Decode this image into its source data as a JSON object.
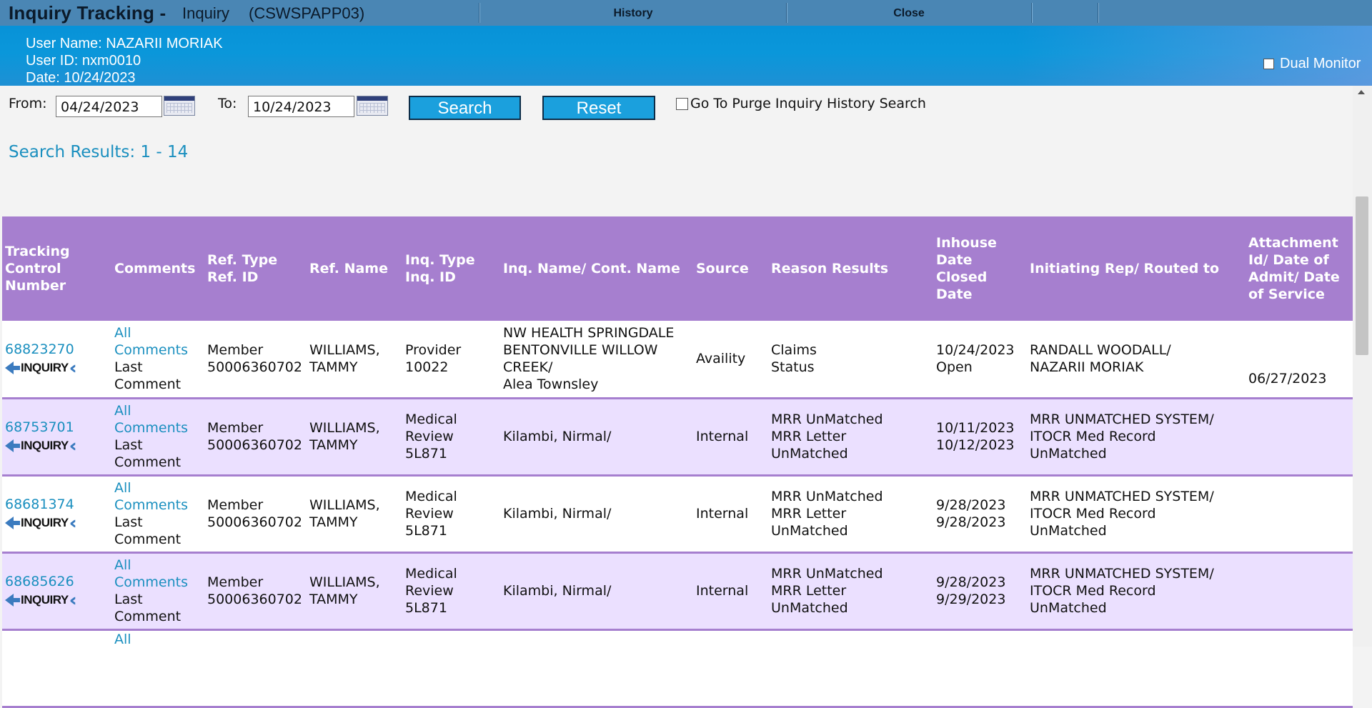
{
  "window": {
    "title": "Inquiry Tracking -",
    "subtitle": "Inquiry",
    "server": "(CSWSPAPP03)",
    "history_label": "History",
    "close_label": "Close"
  },
  "user": {
    "name_line": "User Name: NAZARII MORIAK",
    "id_line": "User ID: nxm0010",
    "date_line": "Date: 10/24/2023",
    "dual_monitor_label": "Dual Monitor",
    "dual_monitor_checked": false
  },
  "search": {
    "from_label": "From:",
    "from_value": "04/24/2023",
    "to_label": "To:",
    "to_value": "10/24/2023",
    "search_button": "Search",
    "reset_button": "Reset",
    "purge_label": "Go To Purge Inquiry History Search",
    "purge_checked": false,
    "results_text": "Search Results: 1 - 14"
  },
  "table": {
    "headers": [
      "Tracking Control Number",
      "Comments",
      "Ref. Type Ref. ID",
      "Ref. Name",
      "Inq. Type Inq. ID",
      "Inq. Name/ Cont. Name",
      "Source",
      "Reason Results",
      "Inhouse Date Closed Date",
      "Initiating Rep/ Routed to",
      "Attachment Id/ Date of Admit/ Date of Service"
    ],
    "logo_text": "INQUIRY",
    "all_comments_label": "All Comments",
    "last_comment_label": "Last Comment",
    "rows": [
      {
        "tracking": "68823270",
        "ref_type": "Member",
        "ref_id": "50006360702",
        "ref_name_1": "WILLIAMS,",
        "ref_name_2": "TAMMY",
        "inq_type_1": "Provider",
        "inq_type_2": "10022",
        "inq_type_3": "",
        "inq_name_1": "NW HEALTH SPRINGDALE",
        "inq_name_2": "BENTONVILLE WILLOW",
        "inq_name_3": "CREEK/",
        "inq_name_4": "Alea Townsley",
        "source": "Availity",
        "reason_1": "Claims",
        "reason_2": "Status",
        "reason_3": "",
        "inhouse_date": "10/24/2023",
        "closed_date": "Open",
        "rep_1": "RANDALL WOODALL/",
        "rep_2": "NAZARII MORIAK",
        "rep_3": "",
        "attachment": "06/27/2023"
      },
      {
        "tracking": "68753701",
        "ref_type": "Member",
        "ref_id": "50006360702",
        "ref_name_1": "WILLIAMS,",
        "ref_name_2": "TAMMY",
        "inq_type_1": "Medical",
        "inq_type_2": "Review",
        "inq_type_3": "5L871",
        "inq_name_1": "Kilambi, Nirmal/",
        "inq_name_2": "",
        "inq_name_3": "",
        "inq_name_4": "",
        "source": "Internal",
        "reason_1": "MRR UnMatched",
        "reason_2": "MRR Letter",
        "reason_3": "UnMatched",
        "inhouse_date": "10/11/2023",
        "closed_date": "10/12/2023",
        "rep_1": "MRR UNMATCHED SYSTEM/",
        "rep_2": "ITOCR Med Record",
        "rep_3": "UnMatched",
        "attachment": ""
      },
      {
        "tracking": "68681374",
        "ref_type": "Member",
        "ref_id": "50006360702",
        "ref_name_1": "WILLIAMS,",
        "ref_name_2": "TAMMY",
        "inq_type_1": "Medical",
        "inq_type_2": "Review",
        "inq_type_3": "5L871",
        "inq_name_1": "Kilambi, Nirmal/",
        "inq_name_2": "",
        "inq_name_3": "",
        "inq_name_4": "",
        "source": "Internal",
        "reason_1": "MRR UnMatched",
        "reason_2": "MRR Letter",
        "reason_3": "UnMatched",
        "inhouse_date": "9/28/2023",
        "closed_date": "9/28/2023",
        "rep_1": "MRR UNMATCHED SYSTEM/",
        "rep_2": "ITOCR Med Record",
        "rep_3": "UnMatched",
        "attachment": ""
      },
      {
        "tracking": "68685626",
        "ref_type": "Member",
        "ref_id": "50006360702",
        "ref_name_1": "WILLIAMS,",
        "ref_name_2": "TAMMY",
        "inq_type_1": "Medical",
        "inq_type_2": "Review",
        "inq_type_3": "5L871",
        "inq_name_1": "Kilambi, Nirmal/",
        "inq_name_2": "",
        "inq_name_3": "",
        "inq_name_4": "",
        "source": "Internal",
        "reason_1": "MRR UnMatched",
        "reason_2": "MRR Letter",
        "reason_3": "UnMatched",
        "inhouse_date": "9/28/2023",
        "closed_date": "9/29/2023",
        "rep_1": "MRR UNMATCHED SYSTEM/",
        "rep_2": "ITOCR Med Record",
        "rep_3": "UnMatched",
        "attachment": ""
      }
    ],
    "partial_row_link": "All"
  },
  "colors": {
    "title_bar": "#4a86b4",
    "user_bar": "#0a97da",
    "header_purple": "#a67fcf",
    "row_alt": "#ebe0ff",
    "link": "#1a8fbf",
    "button": "#1ba0dd"
  }
}
